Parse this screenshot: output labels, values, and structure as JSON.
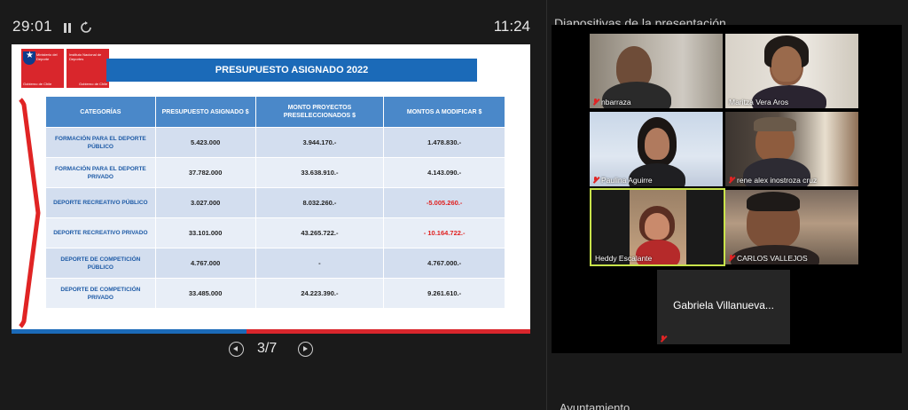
{
  "topbar": {
    "timer": "29:01",
    "clock": "11:24"
  },
  "slide": {
    "logo1_text": "Ministerio del Deporte",
    "logo1_bottom": "Gobierno de Chile",
    "logo2_text": "Instituto Nacional de Deportes",
    "logo2_bottom": "Gobierno de Chile",
    "title": "PRESUPUESTO ASIGNADO 2022",
    "headers": [
      "CATEGORÍAS",
      "PRESUPUESTO ASIGNADO $",
      "MONTO PROYECTOS PRESELECCIONADOS $",
      "MONTOS A MODIFICAR $"
    ],
    "rows": [
      {
        "cat": "FORMACIÓN PARA EL DEPORTE PÚBLICO",
        "asignado": "5.423.000",
        "preseleccionados": "3.944.170.-",
        "modificar": "1.478.830.-",
        "negative": false
      },
      {
        "cat": "FORMACIÓN PARA EL DEPORTE PRIVADO",
        "asignado": "37.782.000",
        "preseleccionados": "33.638.910.-",
        "modificar": "4.143.090.-",
        "negative": false
      },
      {
        "cat": "DEPORTE RECREATIVO PÚBLICO",
        "asignado": "3.027.000",
        "preseleccionados": "8.032.260.-",
        "modificar": "-5.005.260.-",
        "negative": true
      },
      {
        "cat": "DEPORTE RECREATIVO PRIVADO",
        "asignado": "33.101.000",
        "preseleccionados": "43.265.722.-",
        "modificar": "- 10.164.722.-",
        "negative": true
      },
      {
        "cat": "DEPORTE DE COMPETICIÓN PÚBLICO",
        "asignado": "4.767.000",
        "preseleccionados": "-",
        "modificar": "4.767.000.-",
        "negative": false
      },
      {
        "cat": "DEPORTE DE COMPETICIÓN PRIVADO",
        "asignado": "33.485.000",
        "preseleccionados": "24.223.390.-",
        "modificar": "9.261.610.-",
        "negative": false
      }
    ]
  },
  "pager": {
    "label": "3/7"
  },
  "panel": {
    "title": "Diapositivas de la presentación",
    "participants": [
      {
        "name": "nbarraza",
        "muted": true
      },
      {
        "name": "Maritza Vera Aros",
        "muted": false
      },
      {
        "name": "Paulina Aguirre",
        "muted": true
      },
      {
        "name": "rene alex inostroza cruz",
        "muted": true
      },
      {
        "name": "Heddy Escalante",
        "muted": false,
        "active": true
      },
      {
        "name": "CARLOS VALLEJOS",
        "muted": true
      },
      {
        "name": "Gabriela Villanueva...",
        "muted": true,
        "video": false
      }
    ]
  },
  "bottom": {
    "text": "Ayuntamiento"
  },
  "colors": {
    "slide_blue": "#1b6ab8",
    "header_blue": "#4a88c9",
    "brand_red": "#d9262c",
    "negative_red": "#e0201f",
    "active_speaker": "#c8e34a"
  }
}
